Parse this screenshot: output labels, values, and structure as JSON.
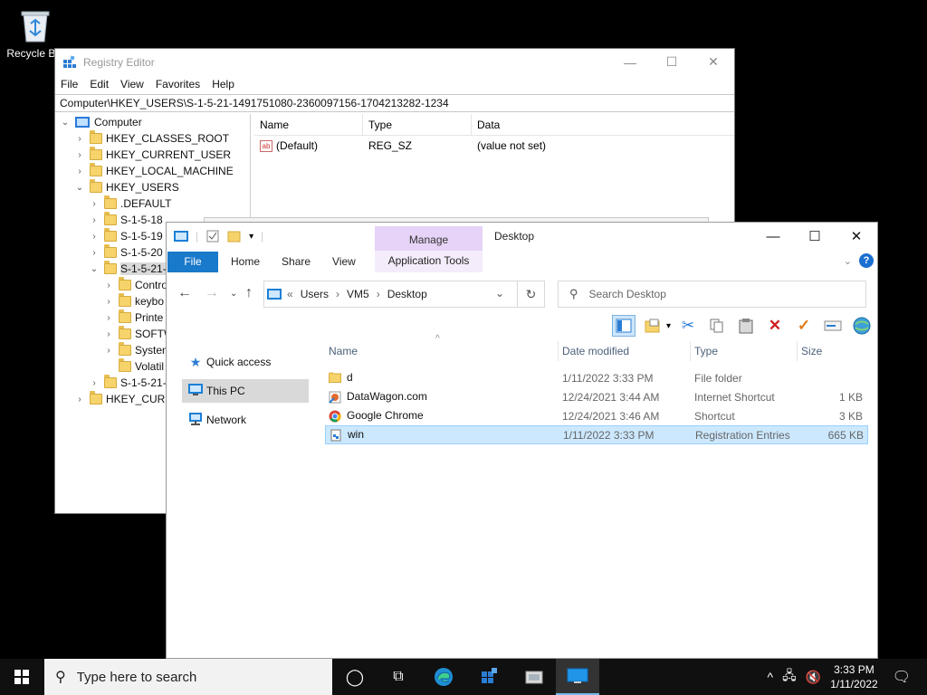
{
  "desktop": {
    "recycle_bin_label": "Recycle Bin"
  },
  "regedit": {
    "title": "Registry Editor",
    "menu": [
      "File",
      "Edit",
      "View",
      "Favorites",
      "Help"
    ],
    "address": "Computer\\HKEY_USERS\\S-1-5-21-1491751080-2360097156-1704213282-1234",
    "tree": {
      "root": "Computer",
      "items": [
        {
          "label": "HKEY_CLASSES_ROOT",
          "chev": "›",
          "indent": 1
        },
        {
          "label": "HKEY_CURRENT_USER",
          "chev": "›",
          "indent": 1
        },
        {
          "label": "HKEY_LOCAL_MACHINE",
          "chev": "›",
          "indent": 1
        },
        {
          "label": "HKEY_USERS",
          "chev": "⌄",
          "indent": 1
        },
        {
          "label": ".DEFAULT",
          "chev": "›",
          "indent": 2
        },
        {
          "label": "S-1-5-18",
          "chev": "›",
          "indent": 2
        },
        {
          "label": "S-1-5-19",
          "chev": "›",
          "indent": 2
        },
        {
          "label": "S-1-5-20",
          "chev": "›",
          "indent": 2
        },
        {
          "label": "S-1-5-21-",
          "chev": "⌄",
          "indent": 2
        },
        {
          "label": "Contro",
          "chev": "›",
          "indent": 3
        },
        {
          "label": "keybo",
          "chev": "›",
          "indent": 3
        },
        {
          "label": "Printe",
          "chev": "›",
          "indent": 3
        },
        {
          "label": "SOFTW",
          "chev": "›",
          "indent": 3
        },
        {
          "label": "System",
          "chev": "›",
          "indent": 3
        },
        {
          "label": "Volatil",
          "chev": "",
          "indent": 3
        },
        {
          "label": "S-1-5-21-",
          "chev": "›",
          "indent": 2
        },
        {
          "label": "HKEY_CURR",
          "chev": "›",
          "indent": 1
        }
      ]
    },
    "columns": [
      "Name",
      "Type",
      "Data"
    ],
    "values": [
      {
        "name": "(Default)",
        "type": "REG_SZ",
        "data": "(value not set)"
      }
    ]
  },
  "explorer": {
    "title": "Desktop",
    "manage_tab": "Manage",
    "tabs": {
      "file": "File",
      "home": "Home",
      "share": "Share",
      "view": "View",
      "app_tools": "Application Tools"
    },
    "breadcrumb": {
      "prefix": "«",
      "parts": [
        "Users",
        "VM5",
        "Desktop"
      ]
    },
    "search_placeholder": "Search Desktop",
    "nav": {
      "quick_access": "Quick access",
      "this_pc": "This PC",
      "network": "Network"
    },
    "columns": {
      "name": "Name",
      "date": "Date modified",
      "type": "Type",
      "size": "Size"
    },
    "files": [
      {
        "name": "d",
        "date": "1/11/2022 3:33 PM",
        "type": "File folder",
        "size": "",
        "icon": "folder-icon"
      },
      {
        "name": "DataWagon.com",
        "date": "12/24/2021 3:44 AM",
        "type": "Internet Shortcut",
        "size": "1 KB",
        "icon": "internet-shortcut-icon"
      },
      {
        "name": "Google Chrome",
        "date": "12/24/2021 3:46 AM",
        "type": "Shortcut",
        "size": "3 KB",
        "icon": "chrome-icon"
      },
      {
        "name": "win",
        "date": "1/11/2022 3:33 PM",
        "type": "Registration Entries",
        "size": "665 KB",
        "icon": "reg-file-icon"
      }
    ],
    "selected_file": "win"
  },
  "taskbar": {
    "search_placeholder": "Type here to search",
    "time": "3:33 PM",
    "date": "1/11/2022"
  },
  "colors": {
    "accent": "#1979ca",
    "manage": "#e6d3f7",
    "selection": "#cce8ff"
  }
}
